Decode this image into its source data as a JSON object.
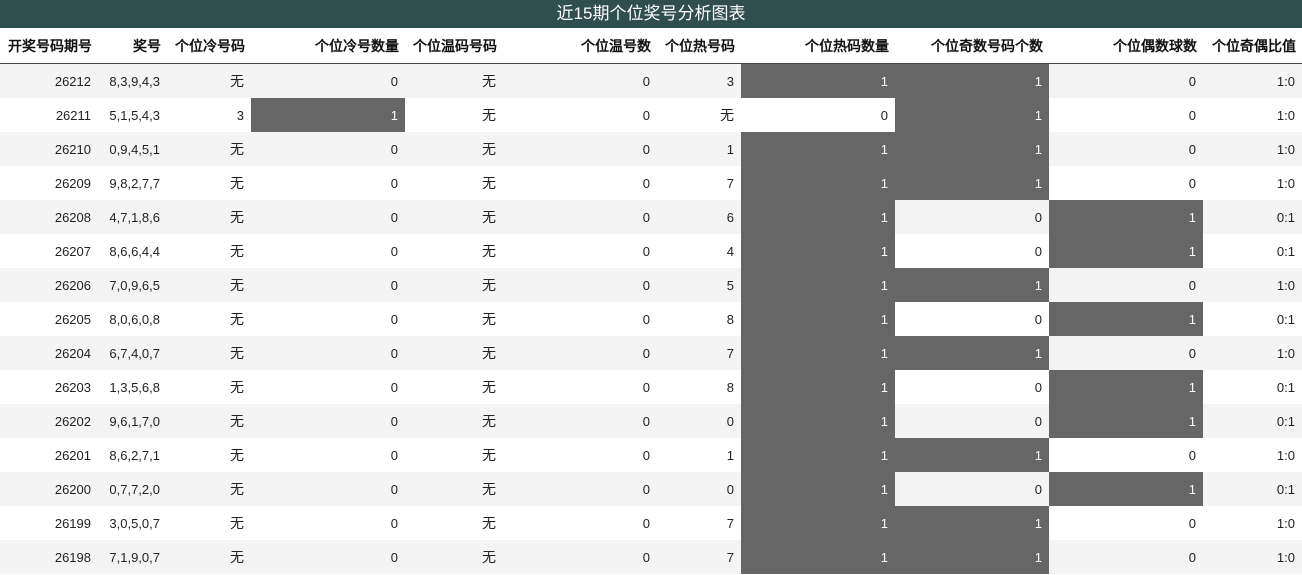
{
  "title": "近15期个位奖号分析图表",
  "columns": [
    "开奖号码期号",
    "奖号",
    "个位冷号码",
    "个位冷号数量",
    "个位温码号码",
    "个位温号数",
    "个位热号码",
    "个位热码数量",
    "个位奇数号码个数",
    "个位偶数球数",
    "个位奇偶比值"
  ],
  "rows": [
    {
      "cells": [
        "26212",
        "8,3,9,4,3",
        "无",
        "0",
        "无",
        "0",
        "3",
        "1",
        "1",
        "0",
        "1:0"
      ],
      "hl": [
        7,
        8
      ]
    },
    {
      "cells": [
        "26211",
        "5,1,5,4,3",
        "3",
        "1",
        "无",
        "0",
        "无",
        "0",
        "1",
        "0",
        "1:0"
      ],
      "hl": [
        3,
        8
      ]
    },
    {
      "cells": [
        "26210",
        "0,9,4,5,1",
        "无",
        "0",
        "无",
        "0",
        "1",
        "1",
        "1",
        "0",
        "1:0"
      ],
      "hl": [
        7,
        8
      ]
    },
    {
      "cells": [
        "26209",
        "9,8,2,7,7",
        "无",
        "0",
        "无",
        "0",
        "7",
        "1",
        "1",
        "0",
        "1:0"
      ],
      "hl": [
        7,
        8
      ]
    },
    {
      "cells": [
        "26208",
        "4,7,1,8,6",
        "无",
        "0",
        "无",
        "0",
        "6",
        "1",
        "0",
        "1",
        "0:1"
      ],
      "hl": [
        7,
        9
      ]
    },
    {
      "cells": [
        "26207",
        "8,6,6,4,4",
        "无",
        "0",
        "无",
        "0",
        "4",
        "1",
        "0",
        "1",
        "0:1"
      ],
      "hl": [
        7,
        9
      ]
    },
    {
      "cells": [
        "26206",
        "7,0,9,6,5",
        "无",
        "0",
        "无",
        "0",
        "5",
        "1",
        "1",
        "0",
        "1:0"
      ],
      "hl": [
        7,
        8
      ]
    },
    {
      "cells": [
        "26205",
        "8,0,6,0,8",
        "无",
        "0",
        "无",
        "0",
        "8",
        "1",
        "0",
        "1",
        "0:1"
      ],
      "hl": [
        7,
        9
      ]
    },
    {
      "cells": [
        "26204",
        "6,7,4,0,7",
        "无",
        "0",
        "无",
        "0",
        "7",
        "1",
        "1",
        "0",
        "1:0"
      ],
      "hl": [
        7,
        8
      ]
    },
    {
      "cells": [
        "26203",
        "1,3,5,6,8",
        "无",
        "0",
        "无",
        "0",
        "8",
        "1",
        "0",
        "1",
        "0:1"
      ],
      "hl": [
        7,
        9
      ]
    },
    {
      "cells": [
        "26202",
        "9,6,1,7,0",
        "无",
        "0",
        "无",
        "0",
        "0",
        "1",
        "0",
        "1",
        "0:1"
      ],
      "hl": [
        7,
        9
      ]
    },
    {
      "cells": [
        "26201",
        "8,6,2,7,1",
        "无",
        "0",
        "无",
        "0",
        "1",
        "1",
        "1",
        "0",
        "1:0"
      ],
      "hl": [
        7,
        8
      ]
    },
    {
      "cells": [
        "26200",
        "0,7,7,2,0",
        "无",
        "0",
        "无",
        "0",
        "0",
        "1",
        "0",
        "1",
        "0:1"
      ],
      "hl": [
        7,
        9
      ]
    },
    {
      "cells": [
        "26199",
        "3,0,5,0,7",
        "无",
        "0",
        "无",
        "0",
        "7",
        "1",
        "1",
        "0",
        "1:0"
      ],
      "hl": [
        7,
        8
      ]
    },
    {
      "cells": [
        "26198",
        "7,1,9,0,7",
        "无",
        "0",
        "无",
        "0",
        "7",
        "1",
        "1",
        "0",
        "1:0"
      ],
      "hl": [
        7,
        8
      ]
    }
  ],
  "colors": {
    "title_bg": "#2f4f4f",
    "highlight": "#666666",
    "stripe": "#f4f4f4"
  }
}
